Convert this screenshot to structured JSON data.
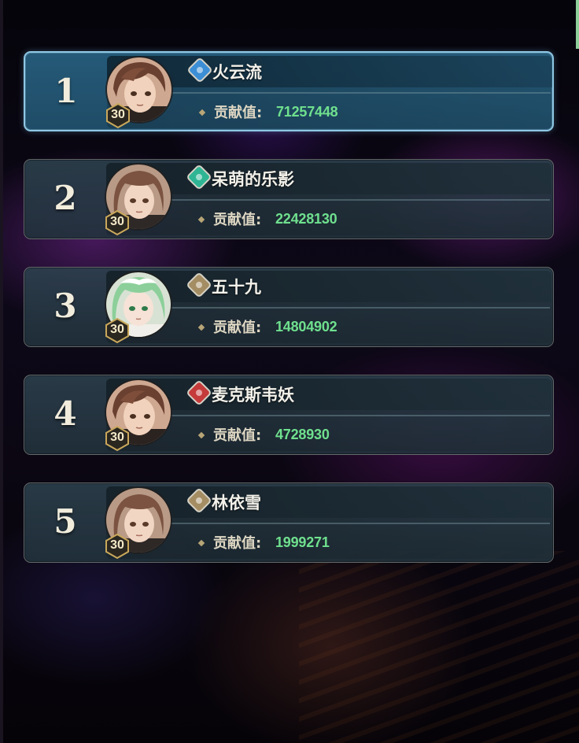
{
  "contribution_label": "贡献值:",
  "colors": {
    "accent_selected": "#8ec7e4",
    "value_green": "#6fe08e"
  },
  "ranking": [
    {
      "rank": "1",
      "name": "火云流",
      "level": "30",
      "contribution": "71257448",
      "element_icon": "water-element-icon",
      "avatar": "brown-hair-eyepatch-avatar",
      "selected": true
    },
    {
      "rank": "2",
      "name": "呆萌的乐影",
      "level": "30",
      "contribution": "22428130",
      "element_icon": "wind-element-icon",
      "avatar": "brown-hair-girl-avatar",
      "selected": false
    },
    {
      "rank": "3",
      "name": "五十九",
      "level": "30",
      "contribution": "14804902",
      "element_icon": "earth-element-icon",
      "avatar": "green-hair-elf-avatar",
      "selected": false
    },
    {
      "rank": "4",
      "name": "麦克斯韦妖",
      "level": "30",
      "contribution": "4728930",
      "element_icon": "fire-element-icon",
      "avatar": "brown-hair-eyepatch-avatar",
      "selected": false
    },
    {
      "rank": "5",
      "name": "林依雪",
      "level": "30",
      "contribution": "1999271",
      "element_icon": "earth-element-icon",
      "avatar": "brown-hair-girl-avatar",
      "selected": false
    }
  ]
}
